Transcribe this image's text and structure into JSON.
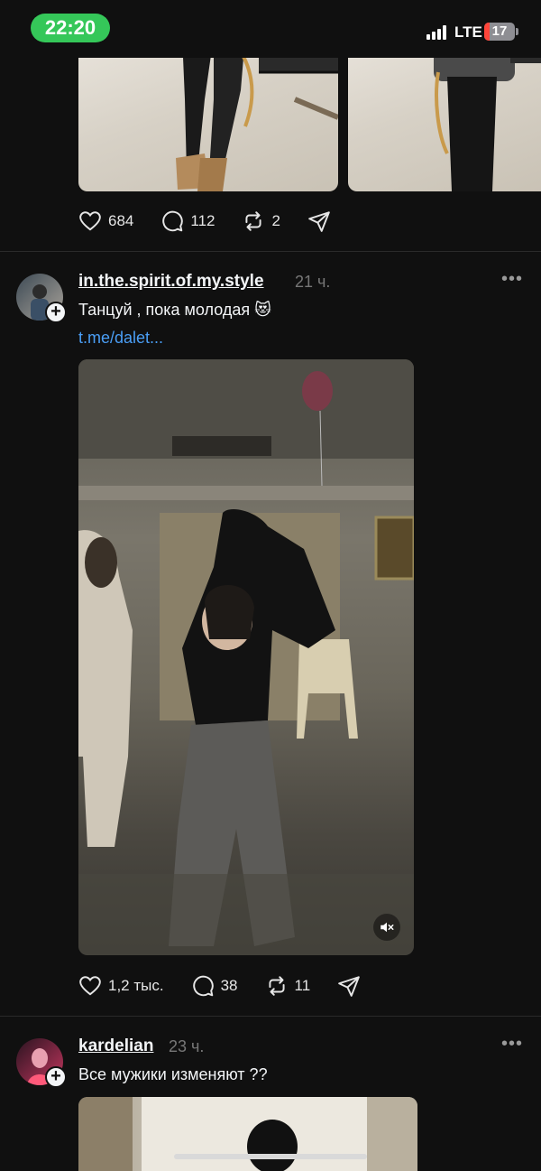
{
  "status": {
    "time": "22:20",
    "network": "LTE",
    "battery": "17",
    "battery_level": 0.17
  },
  "post1": {
    "likes": "684",
    "comments": "112",
    "reposts": "2"
  },
  "post2": {
    "username": "in.the.spirit.of.my.style",
    "time_ago": "21 ч.",
    "caption": "Танцуй , пока молодая 😻",
    "link": "t.me/dalet...",
    "likes": "1,2 тыс.",
    "comments": "38",
    "reposts": "11"
  },
  "post3": {
    "username": "kardelian",
    "time_ago": "23 ч.",
    "caption": "Все мужики изменяют ??"
  },
  "icons": [
    "heart-icon",
    "comment-icon",
    "repost-icon",
    "share-icon",
    "more-icon",
    "mute-icon",
    "plus-icon"
  ],
  "colors": {
    "background": "#101010",
    "link": "#4a9ef5",
    "time_pill": "#35c759",
    "battery_low": "#ff453a"
  }
}
